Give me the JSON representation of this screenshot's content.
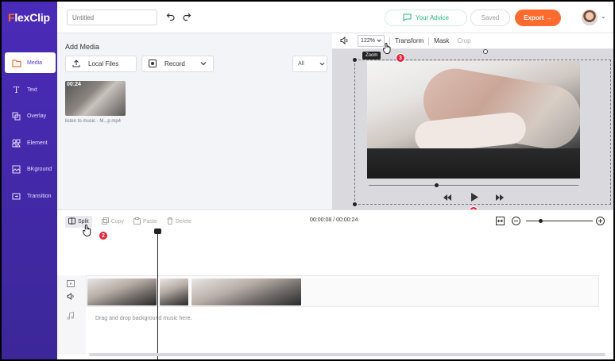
{
  "app": {
    "logo_f": "F",
    "logo_rest": "lexClip"
  },
  "sidebar": {
    "items": [
      {
        "label": "Media",
        "icon": "folder-icon"
      },
      {
        "label": "Text",
        "icon": "text-icon"
      },
      {
        "label": "Overlay",
        "icon": "overlay-icon"
      },
      {
        "label": "Element",
        "icon": "element-icon"
      },
      {
        "label": "BKground",
        "icon": "background-icon"
      },
      {
        "label": "Transition",
        "icon": "transition-icon"
      }
    ]
  },
  "topbar": {
    "title_placeholder": "Untitled",
    "advice_label": "Your Advice",
    "saved_label": "Saved",
    "export_label": "Export →"
  },
  "media": {
    "title": "Add Media",
    "local_files_label": "Local Files",
    "record_label": "Record",
    "filter_label": "All",
    "clip_duration": "00:24",
    "clip_name": "listen to music - M...p.mp4"
  },
  "preview": {
    "zoom_value": "122%",
    "zoom_tooltip": "Zoom",
    "transform_label": "Transform",
    "mask_label": "Mask",
    "crop_label": "Crop"
  },
  "timeline": {
    "split_label": "Split",
    "copy_label": "Copy",
    "paste_label": "Paste",
    "delete_label": "Delete",
    "time_display": "00:00:08 / 00:00:24",
    "music_hint": "Drag and drop background music here."
  },
  "badges": [
    "1",
    "2",
    "3"
  ],
  "colors": {
    "sidebar": "#4a2bb8",
    "accent_orange": "#ff6a2f",
    "advice_green": "#24b47e",
    "badge_red": "#e8233b"
  }
}
